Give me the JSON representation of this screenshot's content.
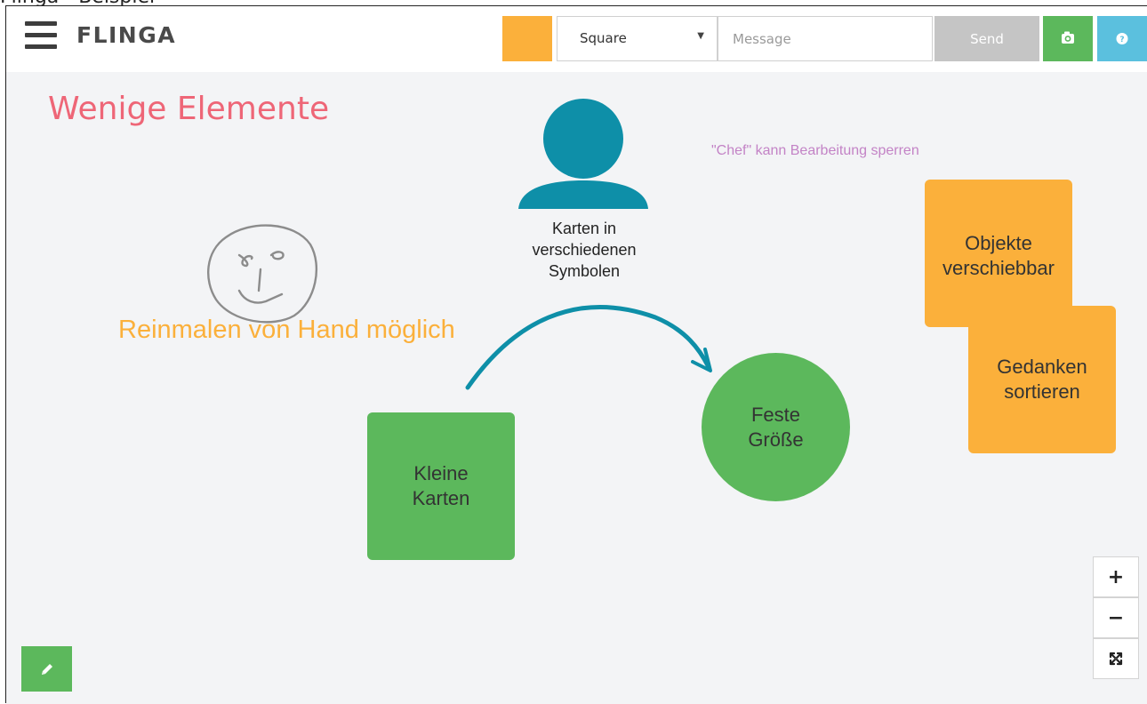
{
  "caption": "Flinga - Beispiel",
  "header": {
    "logo": "FLINGA",
    "color_swatch": "#fbb03b",
    "shape_select": "Square",
    "message_placeholder": "Message",
    "send_label": "Send",
    "icons": [
      "hamburger-menu-icon",
      "camera-icon",
      "help-icon"
    ]
  },
  "board": {
    "title_note": "Wenige Elemente",
    "chef_note": "\"Chef\" kann Bearbeitung sperren",
    "hand_note": "Reinmalen von Hand möglich",
    "person_label": [
      "Karten in",
      "verschiedenen",
      "Symbolen"
    ],
    "green_square": [
      "Kleine",
      "Karten"
    ],
    "green_circle": [
      "Feste",
      "Größe"
    ],
    "orange_card_1": [
      "Objekte",
      "verschiebbar"
    ],
    "orange_card_2": [
      "Gedanken",
      "sortieren"
    ]
  },
  "controls": {
    "zoom_in": "+",
    "zoom_out": "−",
    "icons": [
      "pencil-icon",
      "fit-screen-icon"
    ]
  },
  "colors": {
    "green": "#5cb85c",
    "orange": "#fbb03b",
    "teal": "#0e8fa8",
    "pink": "#ee6677",
    "purple": "#c383c6",
    "blue": "#5bc0de"
  }
}
